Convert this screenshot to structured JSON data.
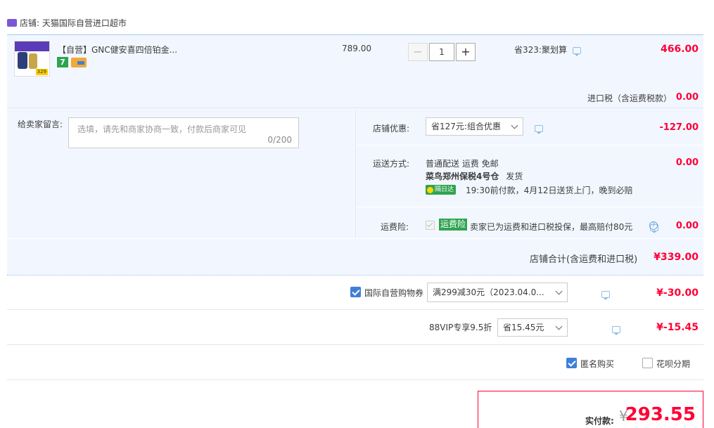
{
  "shop": {
    "label": "店铺: 天猫国际自营进口超市"
  },
  "item": {
    "title": "【自营】GNC健安喜四倍铂金...",
    "unit_price": "789.00",
    "quantity": "1",
    "minus": "−",
    "plus": "+",
    "promo": "省323:聚划算",
    "subtotal": "466.00",
    "tag_seven": "7",
    "thumb_price": "329"
  },
  "import_tax": {
    "label": "进口税（含运费税款）",
    "value": "0.00"
  },
  "message": {
    "label": "给卖家留言:",
    "placeholder": "选填，请先和商家协商一致，付款后商家可见",
    "counter": "0/200"
  },
  "shop_discount": {
    "label": "店铺优惠:",
    "selected": "省127元:组合优惠",
    "value": "-127.00"
  },
  "shipping": {
    "label": "运送方式:",
    "line1": "普通配送 运费 免邮",
    "warehouse": "菜鸟郑州保税4号仓",
    "ship_word": "发货",
    "badge": "隔日达",
    "delivery_note": "19:30前付款，4月12日送货上门，晚到必赔",
    "value": "0.00"
  },
  "insurance": {
    "label": "运费险:",
    "badge": "运费险",
    "text": "卖家已为运费和进口税投保，最高赔付80元",
    "help": "?",
    "value": "0.00"
  },
  "shop_total": {
    "label": "店铺合计(含运费和进口税)",
    "value": "¥339.00"
  },
  "coupon": {
    "label": "国际自营购物券",
    "selected": "满299减30元（2023.04.0...",
    "value": "¥-30.00"
  },
  "vip": {
    "label": "88VIP专享9.5折",
    "selected": "省15.45元",
    "value": "¥-15.45"
  },
  "options": {
    "anonymous": "匿名购买",
    "huabei": "花呗分期"
  },
  "payment": {
    "label": "实付款:",
    "currency": "¥",
    "value": "293.55"
  },
  "colors": {
    "accent_red": "#ff0036",
    "row_bg": "#f2f7ff",
    "checkbox_blue": "#3f7fd9",
    "badge_green": "#2ea44f"
  }
}
